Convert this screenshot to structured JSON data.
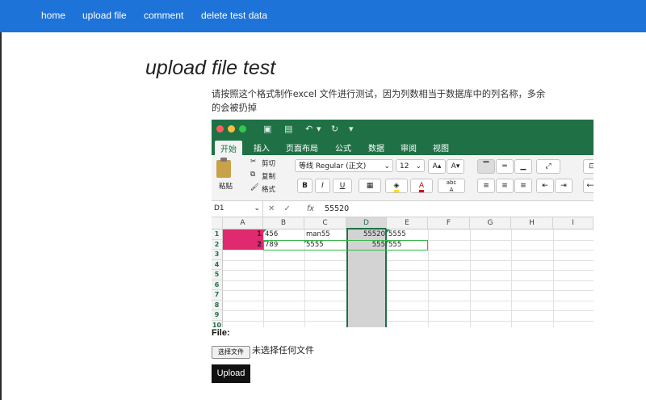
{
  "nav": {
    "items": [
      {
        "label": "home"
      },
      {
        "label": "upload file"
      },
      {
        "label": "comment"
      },
      {
        "label": "delete test data"
      }
    ]
  },
  "page": {
    "title": "upload file test",
    "description": "请按照这个格式制作excel 文件进行测试，因为列数相当于数据库中的列名称，多余的会被扔掉"
  },
  "excel": {
    "ribbon_tabs": [
      "开始",
      "插入",
      "页面布局",
      "公式",
      "数据",
      "审阅",
      "视图"
    ],
    "active_tab": "开始",
    "clipboard": {
      "paste": "粘贴",
      "cut": "剪切",
      "copy": "复制",
      "format": "格式"
    },
    "font_name": "等线 Regular (正文)",
    "font_size": "12",
    "bold": "B",
    "italic": "I",
    "underline": "U",
    "grow_font": "A▴",
    "shrink_font": "A▾",
    "phonetic": "abc",
    "name_box": "D1",
    "fx": "fx",
    "formula_value": "55520",
    "columns": [
      "A",
      "B",
      "C",
      "D",
      "E",
      "F",
      "G",
      "H",
      "I"
    ],
    "selected_column": "D",
    "rows": [
      "1",
      "2",
      "3",
      "4",
      "5",
      "6",
      "7",
      "8",
      "9",
      "10"
    ],
    "cells": [
      [
        "1",
        "456",
        "man55",
        "55520",
        "5555"
      ],
      [
        "2",
        "789",
        "5555",
        "555",
        "555"
      ]
    ],
    "colors": {
      "excel_green": "#1f7145",
      "highlight": "#e0296e"
    }
  },
  "form": {
    "file_label": "File:",
    "choose_button": "选择文件",
    "no_file_text": "未选择任何文件",
    "upload_button": "Upload"
  },
  "colors": {
    "nav_bg": "#1e73d8",
    "button_bg": "#111111"
  }
}
